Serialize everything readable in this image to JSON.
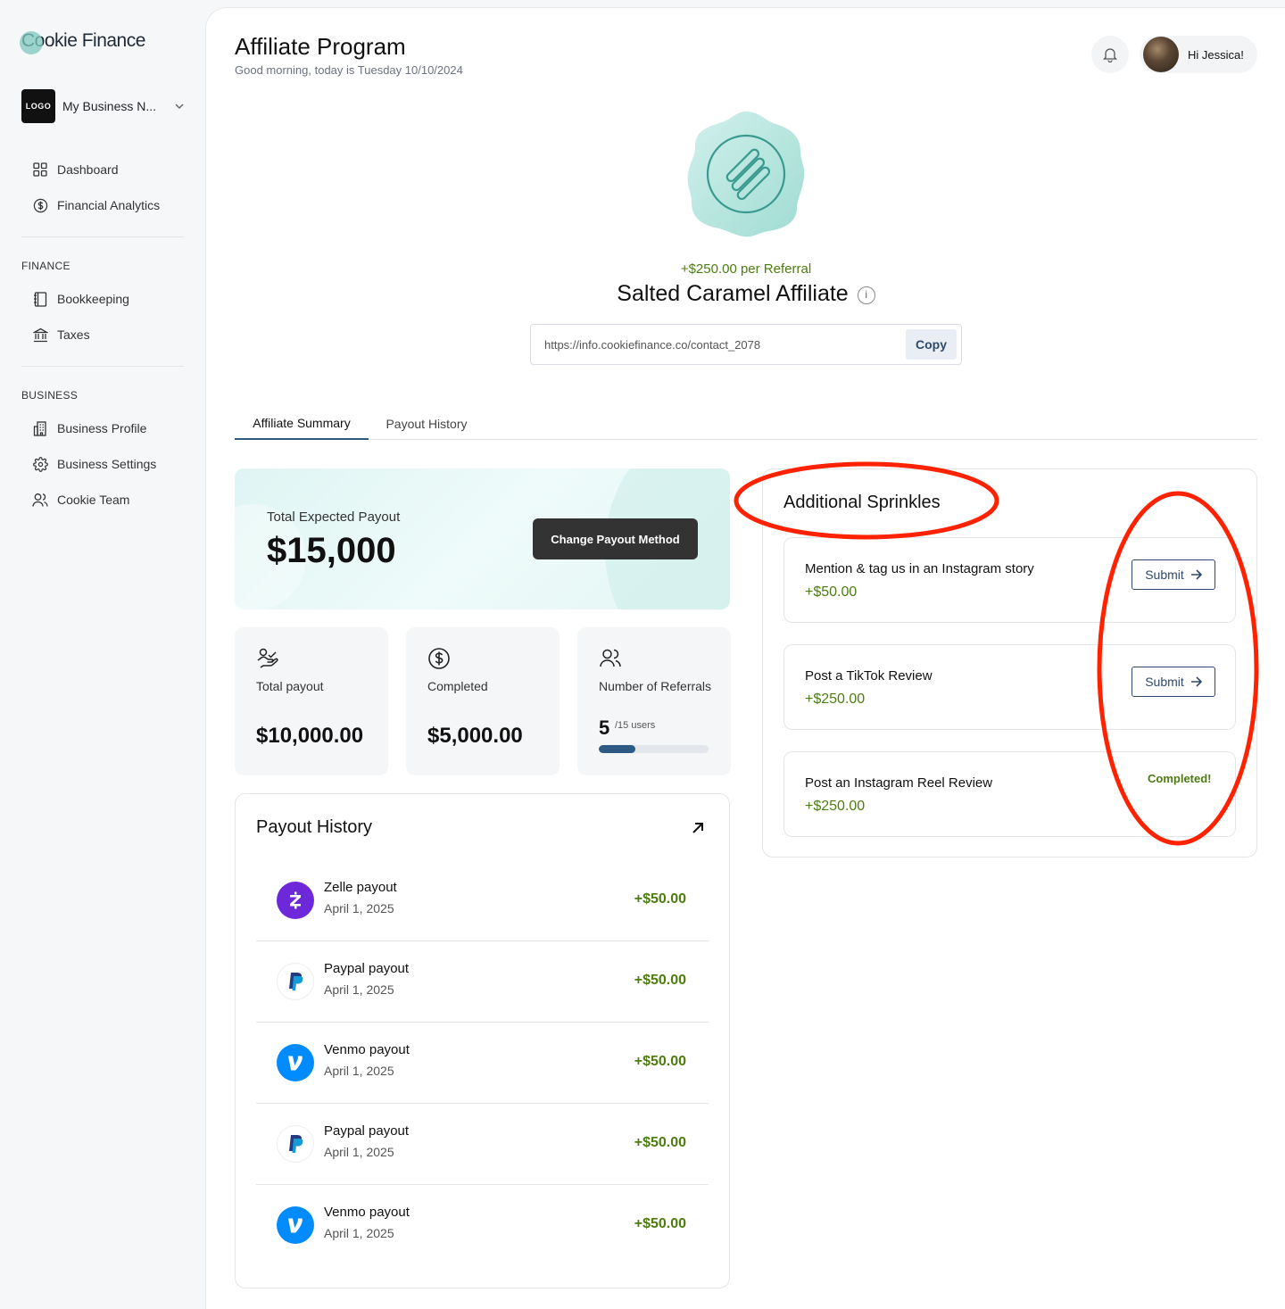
{
  "brand": {
    "name": "Cookie Finance",
    "accent": "#7ec8bd"
  },
  "business": {
    "logo_text": "LOGO",
    "name": "My Business N..."
  },
  "nav": {
    "main": [
      {
        "label": "Dashboard",
        "icon": "grid-icon"
      },
      {
        "label": "Financial Analytics",
        "icon": "dollar-circle-icon"
      }
    ],
    "finance_heading": "FINANCE",
    "finance": [
      {
        "label": "Bookkeeping",
        "icon": "book-icon"
      },
      {
        "label": "Taxes",
        "icon": "bank-icon"
      }
    ],
    "business_heading": "BUSINESS",
    "business": [
      {
        "label": "Business Profile",
        "icon": "building-icon"
      },
      {
        "label": "Business Settings",
        "icon": "gear-icon"
      },
      {
        "label": "Cookie Team",
        "icon": "users-icon"
      }
    ]
  },
  "header": {
    "title": "Affiliate Program",
    "subtitle": "Good morning, today is Tuesday 10/10/2024",
    "greeting": "Hi Jessica!"
  },
  "affiliate": {
    "per_referral": "+$250.00 per Referral",
    "name": "Salted Caramel Affiliate",
    "info_glyph": "i",
    "link": "https://info.cookiefinance.co/contact_2078",
    "copy_label": "Copy"
  },
  "tabs": [
    {
      "label": "Affiliate Summary",
      "active": true
    },
    {
      "label": "Payout History",
      "active": false
    }
  ],
  "payout": {
    "label": "Total Expected Payout",
    "amount": "$15,000",
    "change_label": "Change Payout Method"
  },
  "stats": {
    "total_label": "Total payout",
    "total_value": "$10,000.00",
    "completed_label": "Completed",
    "completed_value": "$5,000.00",
    "referrals_label": "Number of Referrals",
    "referrals_count": "5",
    "referrals_total": "/15 users",
    "referrals_progress": 0.3333
  },
  "history": {
    "title": "Payout History",
    "rows": [
      {
        "name": "Zelle payout",
        "date": "April 1, 2025",
        "amount": "+$50.00",
        "provider": "zelle"
      },
      {
        "name": "Paypal payout",
        "date": "April 1, 2025",
        "amount": "+$50.00",
        "provider": "paypal"
      },
      {
        "name": "Venmo payout",
        "date": "April 1, 2025",
        "amount": "+$50.00",
        "provider": "venmo"
      },
      {
        "name": "Paypal payout",
        "date": "April 1, 2025",
        "amount": "+$50.00",
        "provider": "paypal"
      },
      {
        "name": "Venmo payout",
        "date": "April 1, 2025",
        "amount": "+$50.00",
        "provider": "venmo"
      }
    ]
  },
  "sprinkles": {
    "title": "Additional Sprinkles",
    "submit_label": "Submit",
    "tasks": [
      {
        "name": "Mention & tag us in an Instagram story",
        "reward": "+$50.00",
        "status": "submit"
      },
      {
        "name": "Post a TikTok Review",
        "reward": "+$250.00",
        "status": "submit"
      },
      {
        "name": "Post an Instagram Reel Review",
        "reward": "+$250.00",
        "status": "Completed!"
      }
    ]
  },
  "colors": {
    "green": "#4d7c0f",
    "navy": "#2e4a6b",
    "annotation": "#ff2200",
    "zelle": "#6d28d9",
    "venmo": "#008cff",
    "paypal_dark": "#253b80",
    "paypal_light": "#179bd7"
  }
}
